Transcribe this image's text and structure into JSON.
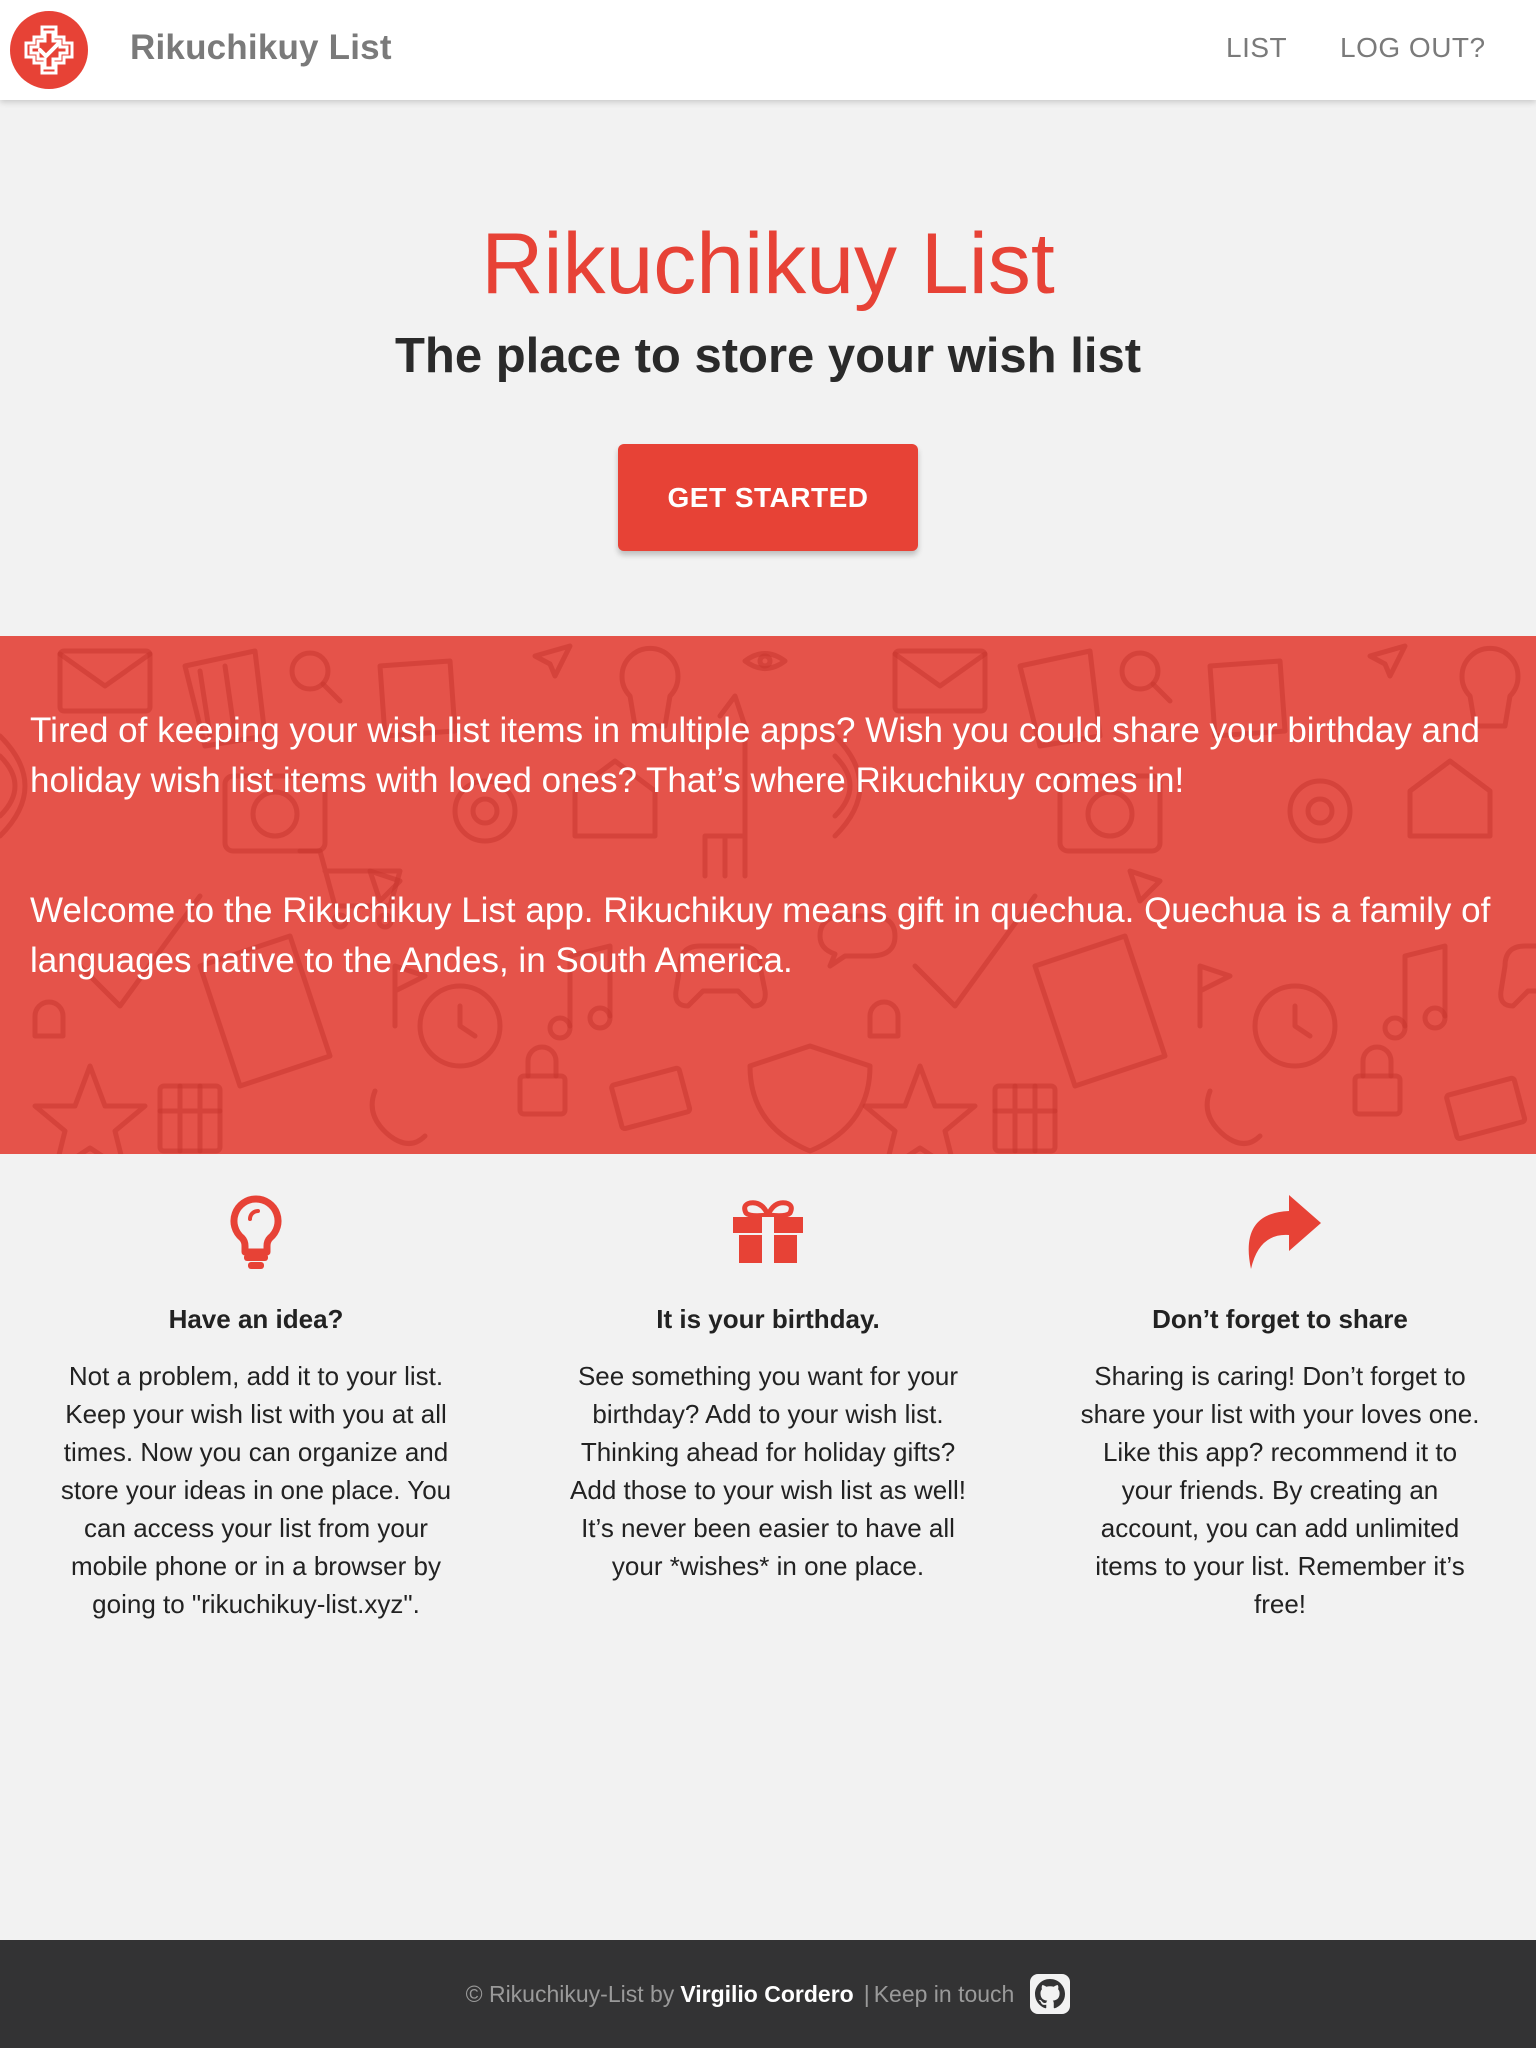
{
  "colors": {
    "accent": "#e74236",
    "band": "#e5534a",
    "footer_bg": "#333334",
    "page_bg": "#f2f2f2"
  },
  "navbar": {
    "logo_icon": "gift-cross-logo-icon",
    "brand": "Rikuchikuy List",
    "links": [
      {
        "label": "LIST"
      },
      {
        "label": "LOG OUT?"
      }
    ]
  },
  "hero": {
    "title": "Rikuchikuy List",
    "subtitle": "The place to store your wish list",
    "cta_label": "GET STARTED"
  },
  "band": {
    "paragraph_1": "Tired of keeping your wish list items in multiple apps? Wish you could share your birthday and holiday wish list items with loved ones? That’s where Rikuchikuy comes in!",
    "paragraph_2": "Welcome to the Rikuchikuy List app. Rikuchikuy means gift in quechua. Quechua is a family of languages native to the Andes, in South America."
  },
  "features": [
    {
      "icon": "lightbulb-icon",
      "title": "Have an idea?",
      "text": "Not a problem, add it to your list. Keep your wish list with you at all times. Now you can organize and store your ideas in one place. You can access your list from your mobile phone or in a browser by going to \"rikuchikuy-list.xyz\"."
    },
    {
      "icon": "gift-icon",
      "title": "It is your birthday.",
      "text": "See something you want for your birthday? Add to your wish list. Thinking ahead for holiday gifts? Add those to your wish list as well! It’s never been easier to have all your *wishes* in one place."
    },
    {
      "icon": "share-arrow-icon",
      "title": "Don’t forget to share",
      "text": "Sharing is caring! Don’t forget to share your list with your loves one. Like this app? recommend it to your friends. By creating an account, you can add unlimited items to your list. Remember it’s free!"
    }
  ],
  "footer": {
    "prefix": "© Rikuchikuy-List by",
    "author": "Virgilio Cordero",
    "separator": "|",
    "keep_in_touch": "Keep in touch",
    "github_icon": "github-icon"
  }
}
